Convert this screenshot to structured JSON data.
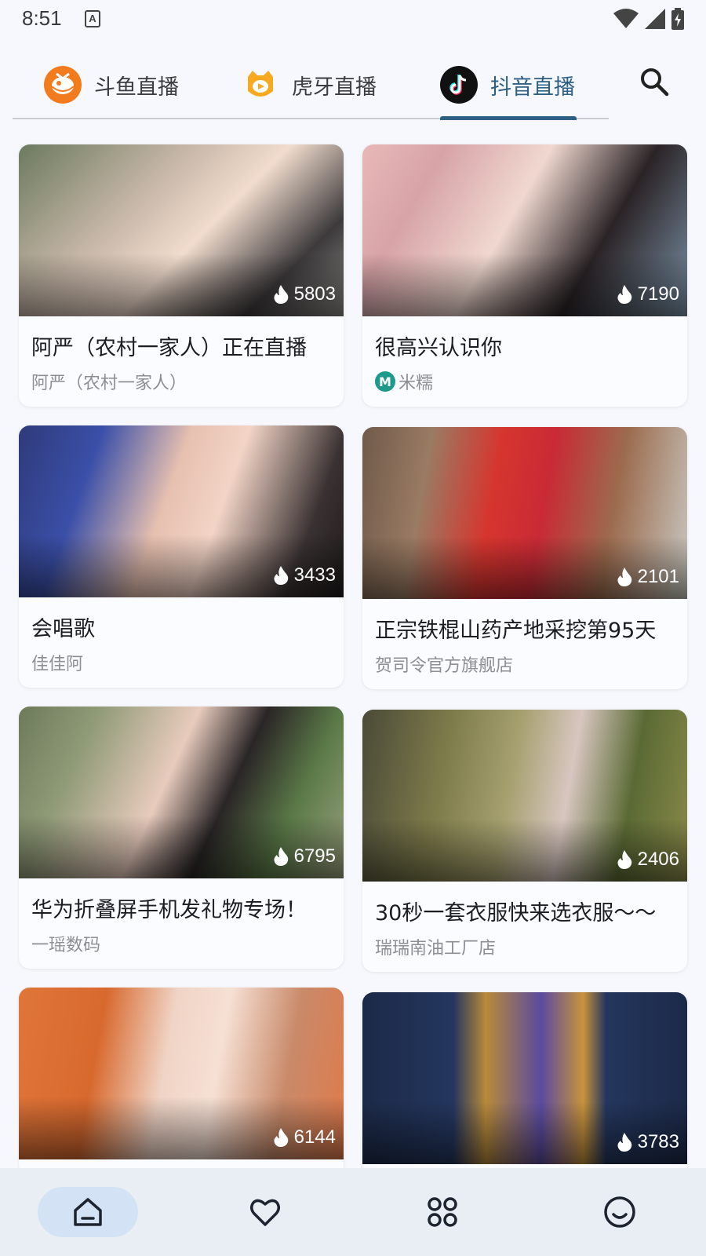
{
  "status_bar": {
    "time": "8:51",
    "notification_icon": "A"
  },
  "tabs": [
    {
      "label": "斗鱼直播",
      "icon": "douyu-logo-icon",
      "active": false
    },
    {
      "label": "虎牙直播",
      "icon": "huya-logo-icon",
      "active": false
    },
    {
      "label": "抖音直播",
      "icon": "douyin-logo-icon",
      "active": true
    }
  ],
  "colors": {
    "accent": "#2e5f85",
    "background": "#f6f8fd",
    "nav_bg": "#e9edf4",
    "nav_active": "#d3e3f5"
  },
  "cards": [
    {
      "title": "阿严（农村一家人）正在直播",
      "author": "阿严（农村一家人）",
      "viewers": "5803"
    },
    {
      "title": "很高兴认识你",
      "author": "米糯",
      "viewers": "7190",
      "author_badge": "M"
    },
    {
      "title": "会唱歌",
      "author": "佳佳阿",
      "viewers": "3433"
    },
    {
      "title": "正宗铁棍山药产地采挖第95天",
      "author": "贺司令官方旗舰店",
      "viewers": "2101"
    },
    {
      "title": "华为折叠屏手机发礼物专场！",
      "author": "一瑶数码",
      "viewers": "6795"
    },
    {
      "title": "30秒一套衣服快来选衣服～～",
      "author": "瑞瑞南油工厂店",
      "viewers": "2406"
    },
    {
      "title": "",
      "author": "",
      "viewers": "6144"
    },
    {
      "title": "",
      "author": "",
      "viewers": "3783"
    }
  ],
  "bottom_nav": [
    {
      "icon": "home-icon",
      "active": true
    },
    {
      "icon": "heart-icon",
      "active": false
    },
    {
      "icon": "categories-icon",
      "active": false
    },
    {
      "icon": "smiley-icon",
      "active": false
    }
  ]
}
